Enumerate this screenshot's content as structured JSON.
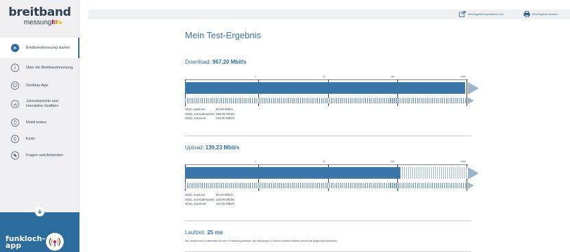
{
  "sidebar": {
    "logo_main": "breitband",
    "logo_sub": "messung",
    "items": [
      {
        "label": "Breitbandmessung starten",
        "icon": "play-icon"
      },
      {
        "label": "Über die Breitbandmessung",
        "icon": "info-icon"
      },
      {
        "label": "Desktop-App",
        "icon": "desktop-icon"
      },
      {
        "label": "Jahresberichte und interaktive Grafiken",
        "icon": "chart-icon"
      },
      {
        "label": "Mobil testen",
        "icon": "mobile-icon"
      },
      {
        "label": "Karte",
        "icon": "map-pin-icon"
      },
      {
        "label": "Fragen und Antworten",
        "icon": "chat-icon"
      }
    ],
    "funkloch_label": "funkloch-app"
  },
  "topbar": {
    "export_label": "Mein Ergebnis exportieren (.csv)",
    "print_label": "Mein Ergebnis drucken"
  },
  "page_title": "Mein Test-Ergebnis",
  "download": {
    "label": "Download:",
    "value": "967,20 Mbit/s",
    "fill_fraction": 0.99,
    "scale_ticks": [
      "1",
      "10",
      "100",
      "1000"
    ]
  },
  "upload": {
    "label": "Upload:",
    "value": "139,23 Mbit/s",
    "fill_fraction": 0.76,
    "scale_ticks": [
      "1",
      "10",
      "100",
      "1000"
    ]
  },
  "soll": {
    "min_label": "SOLL minimal:",
    "min_value": "90,00 Mbit/s",
    "normal_label": "SOLL normalerweise:",
    "normal_value": "100,00 Mbit/s",
    "max_label": "SOLL maximal:",
    "max_value": "110,00 Mbit/s"
  },
  "latency": {
    "label": "Laufzeit:",
    "value": "25 ms",
    "note": "Die Laufzeit wird zu definierten Servern in Frankfurt gemessen. Bei Messungen zu Servern anderer Anbieter können die Ergebnisse abweichen."
  },
  "colors": {
    "accent": "#3a76a8",
    "sidebar_bg": "#f0f0f2",
    "funkloch_bg": "#2c6c9c"
  }
}
